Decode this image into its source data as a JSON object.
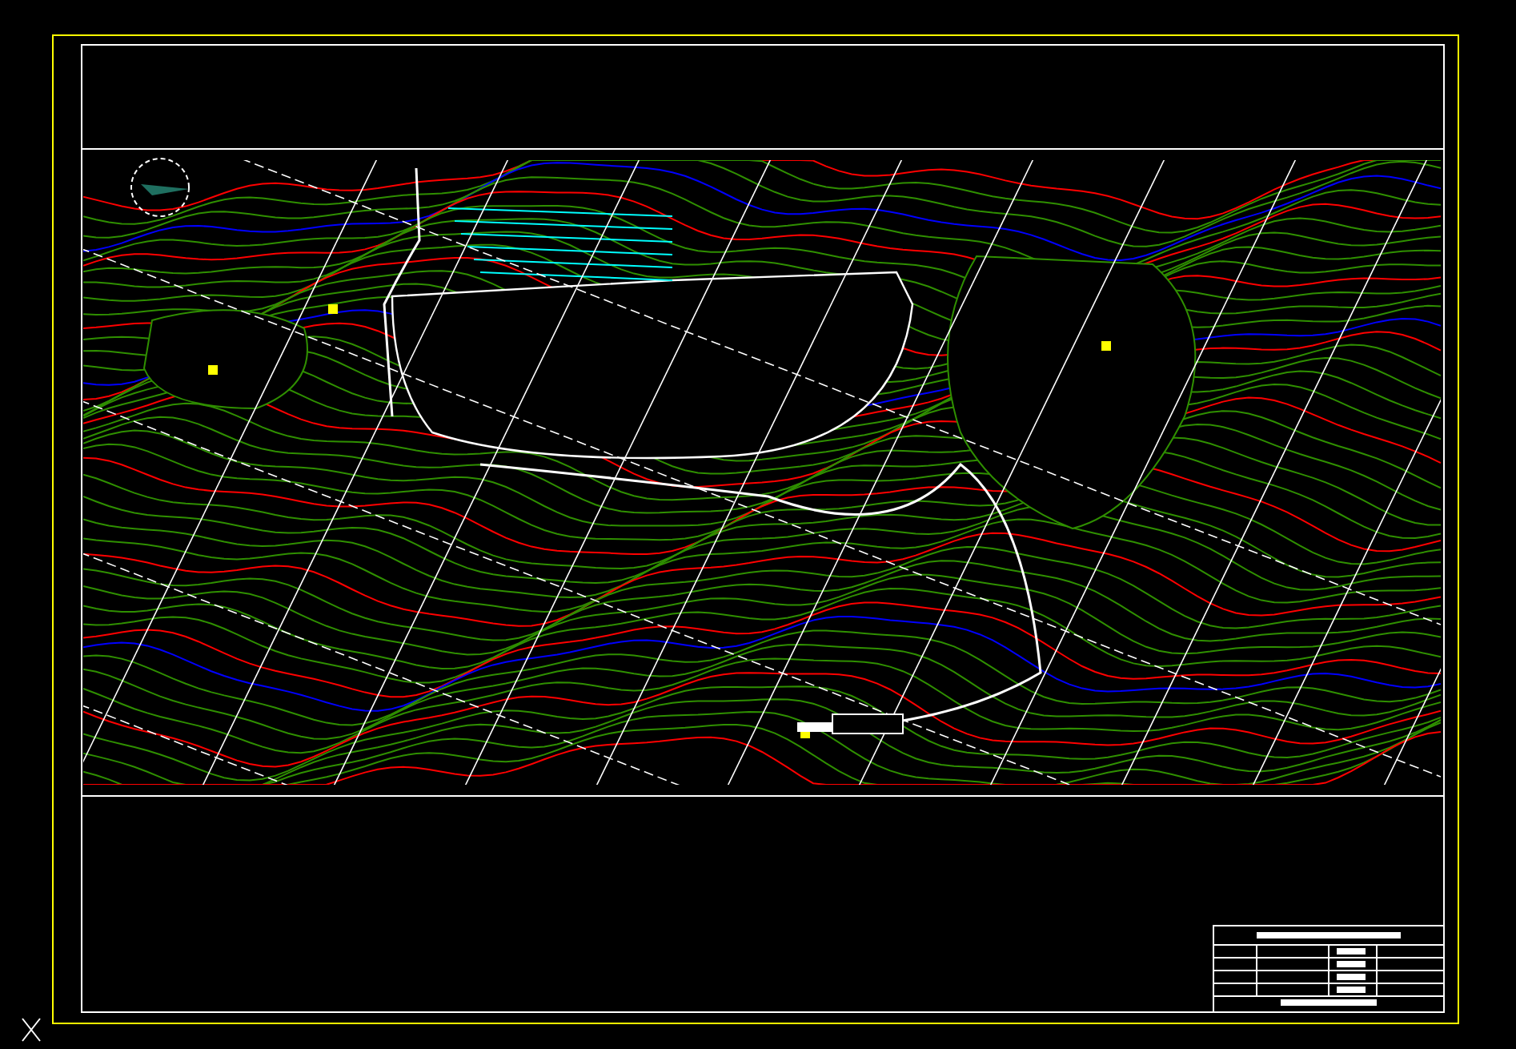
{
  "drawing": {
    "kind": "topographic-plan",
    "title_block": true
  }
}
